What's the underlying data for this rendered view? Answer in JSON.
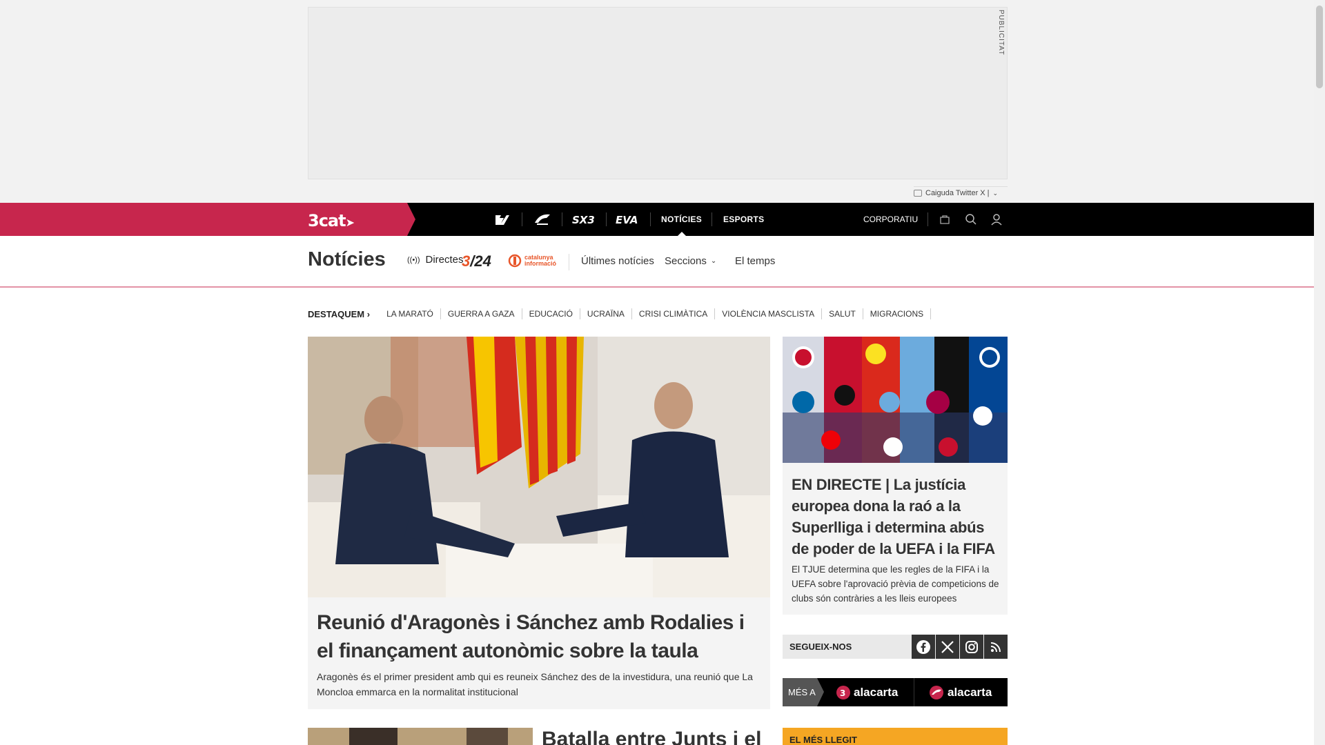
{
  "ad": {
    "label": "PUBLICITAT",
    "ticker_text": "Caiguda Twitter X |"
  },
  "topnav": {
    "brand": "3cat",
    "channels": [
      "3",
      "CatRàdio",
      "SX3",
      "EVA"
    ],
    "links": [
      "NOTÍCIES",
      "ESPORTS"
    ],
    "active_link": "NOTÍCIES",
    "corporate": "CORPORATIU"
  },
  "section": {
    "title": "Notícies",
    "directes": "Directes",
    "logo_324": "3/24",
    "logo_catinfo": "catalunya informació",
    "links": [
      "Últimes notícies",
      "Seccions",
      "El temps"
    ]
  },
  "destaquem": {
    "label": "DESTAQUEM",
    "items": [
      "LA MARATÓ",
      "GUERRA A GAZA",
      "EDUCACIÓ",
      "UCRAÏNA",
      "CRISI CLIMÀTICA",
      "VIOLÈNCIA MASCLISTA",
      "SALUT",
      "MIGRACIONS"
    ]
  },
  "main_article": {
    "title": "Reunió d'Aragonès i Sánchez amb Rodalies i el finançament autonòmic sobre la taula",
    "lead": "Aragonès és el primer president amb qui es reuneix Sánchez des de la investidura, una reunió que La Moncloa emmarca en la normalitat institucional"
  },
  "second_article": {
    "title": "Batalla entre Junts i el"
  },
  "right_article": {
    "title": "EN DIRECTE | La justícia europea dona la raó a la Superlliga i determina abús de poder de la UEFA i la FIFA",
    "lead": "El TJUE determina que les regles de la FIFA i la UEFA sobre l'aprovació prèvia de competicions de clubs són contràries a les lleis europees"
  },
  "social": {
    "label": "SEGUEIX-NOS",
    "networks": [
      "facebook",
      "x",
      "instagram",
      "rss"
    ]
  },
  "mes_a": {
    "label": "MÉS A",
    "items": [
      "alacarta",
      "alacarta"
    ]
  },
  "mes_llegit": {
    "label": "EL MÉS LLEGIT"
  },
  "colors": {
    "brand": "#c7264d",
    "nav_bg": "#000000",
    "accent_orange": "#e8562a",
    "mes_llegit": "#f5a623"
  }
}
